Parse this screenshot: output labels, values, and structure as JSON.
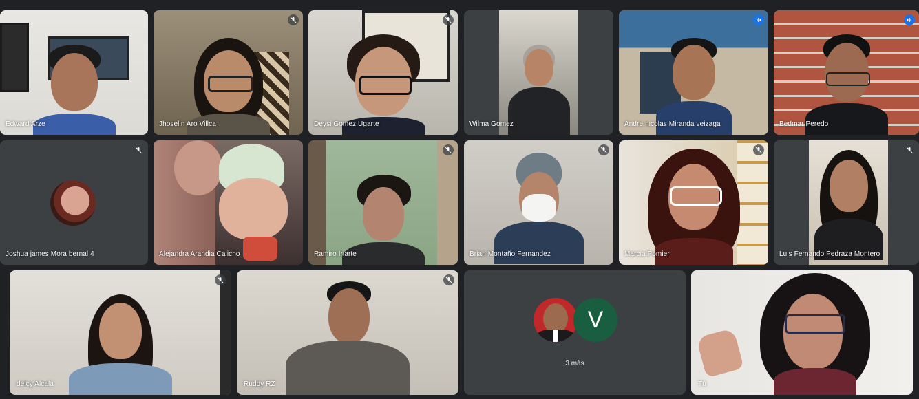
{
  "participants": [
    {
      "name": "Edward Arze",
      "mic": "none"
    },
    {
      "name": "Jhoselin Aro Villca",
      "mic": "muted"
    },
    {
      "name": "Deysi Gomez Ugarte",
      "mic": "muted"
    },
    {
      "name": "Wilma Gomez",
      "mic": "none"
    },
    {
      "name": "Andre nicolas Miranda veizaga",
      "mic": "speaking"
    },
    {
      "name": "Bedmar Peredo",
      "mic": "speaking"
    },
    {
      "name": "Joshua james Mora bernal 4",
      "mic": "muted"
    },
    {
      "name": "Alejandra Arandia Calicho",
      "mic": "none"
    },
    {
      "name": "Ramiro Iriarte",
      "mic": "muted"
    },
    {
      "name": "Brian Montaño Fernandez",
      "mic": "muted"
    },
    {
      "name": "Marcia Pomier",
      "mic": "muted"
    },
    {
      "name": "Luis Fernando Pedraza Montero",
      "mic": "muted"
    },
    {
      "name": "delcy Alcalá",
      "mic": "muted"
    },
    {
      "name": "Ruddy RZ",
      "mic": "muted"
    },
    {
      "name": "Tú",
      "mic": "none"
    }
  ],
  "more_tile": {
    "label": "3 más",
    "avatar_letter": "V"
  },
  "colors": {
    "background": "#202124",
    "tile": "#3c4043",
    "speaking_border": "#8ab4f8",
    "speaking_indicator": "#1a73e8",
    "letter_avatar": "#185e3f"
  },
  "icons": {
    "muted": "mic-off-icon",
    "speaking": "audio-level-icon"
  }
}
